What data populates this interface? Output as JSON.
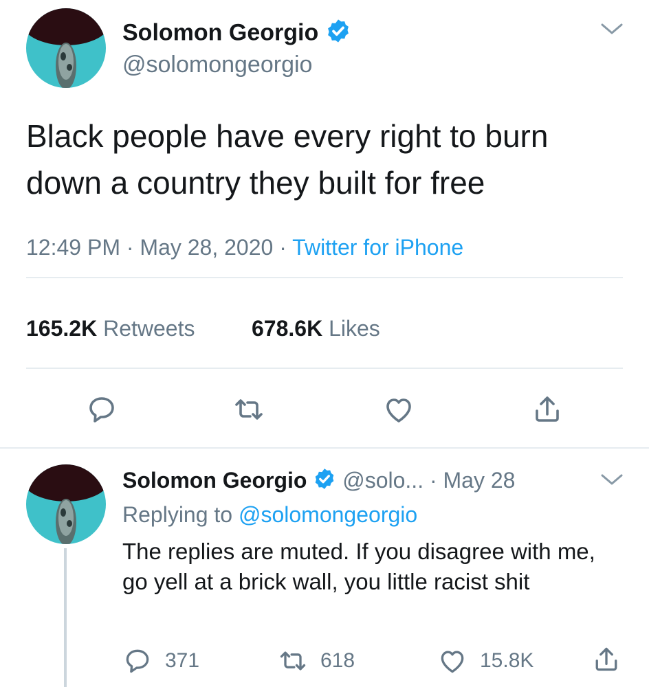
{
  "main_tweet": {
    "author_name": "Solomon Georgio",
    "author_handle": "@solomongeorgio",
    "text": "Black people have every right to burn down a country they built for free",
    "time": "12:49 PM",
    "date": "May 28, 2020",
    "source": "Twitter for iPhone",
    "separator": "·",
    "retweets_count": "165.2K",
    "retweets_label": "Retweets",
    "likes_count": "678.6K",
    "likes_label": "Likes",
    "actions": [
      "reply-icon",
      "retweet-icon",
      "like-icon",
      "share-icon"
    ]
  },
  "reply_tweet": {
    "author_name": "Solomon Georgio",
    "author_handle": "@solo...",
    "separator": "·",
    "date": "May 28",
    "replying_prefix": "Replying to",
    "replying_mention": "@solomongeorgio",
    "text": "The replies are muted. If you disagree with me, go yell at a brick wall, you little racist shit",
    "reply_count": "371",
    "retweet_count": "618",
    "like_count": "15.8K"
  },
  "colors": {
    "accent": "#1da1f2",
    "secondary_text": "#657786",
    "avatar_bg": "#3fc1c9",
    "avatar_dark": "#2a0d12"
  }
}
